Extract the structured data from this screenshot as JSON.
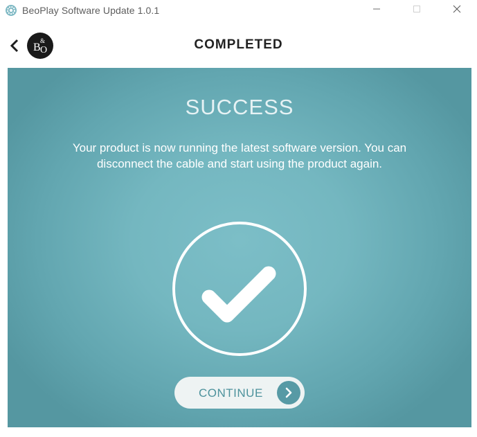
{
  "window": {
    "title": "BeoPlay Software Update 1.0.1",
    "icons": {
      "app": "gear-app-icon",
      "minimize": "minimize-icon",
      "maximize": "maximize-icon",
      "close": "close-icon"
    }
  },
  "header": {
    "back_icon": "chevron-left-icon",
    "logo_text": "B&O",
    "title": "COMPLETED"
  },
  "main": {
    "heading": "SUCCESS",
    "message": "Your product is now running the latest software version. You can disconnect the cable and start using the product again.",
    "status_icon": "checkmark-circle-icon",
    "continue_label": "CONTINUE",
    "continue_icon": "chevron-right-icon"
  },
  "colors": {
    "panel_center": "#7cbec7",
    "panel_edge": "#5597a1",
    "accent": "#579aa5",
    "button_bg": "#eef3f3",
    "heading_text": "#e6f2f4"
  }
}
